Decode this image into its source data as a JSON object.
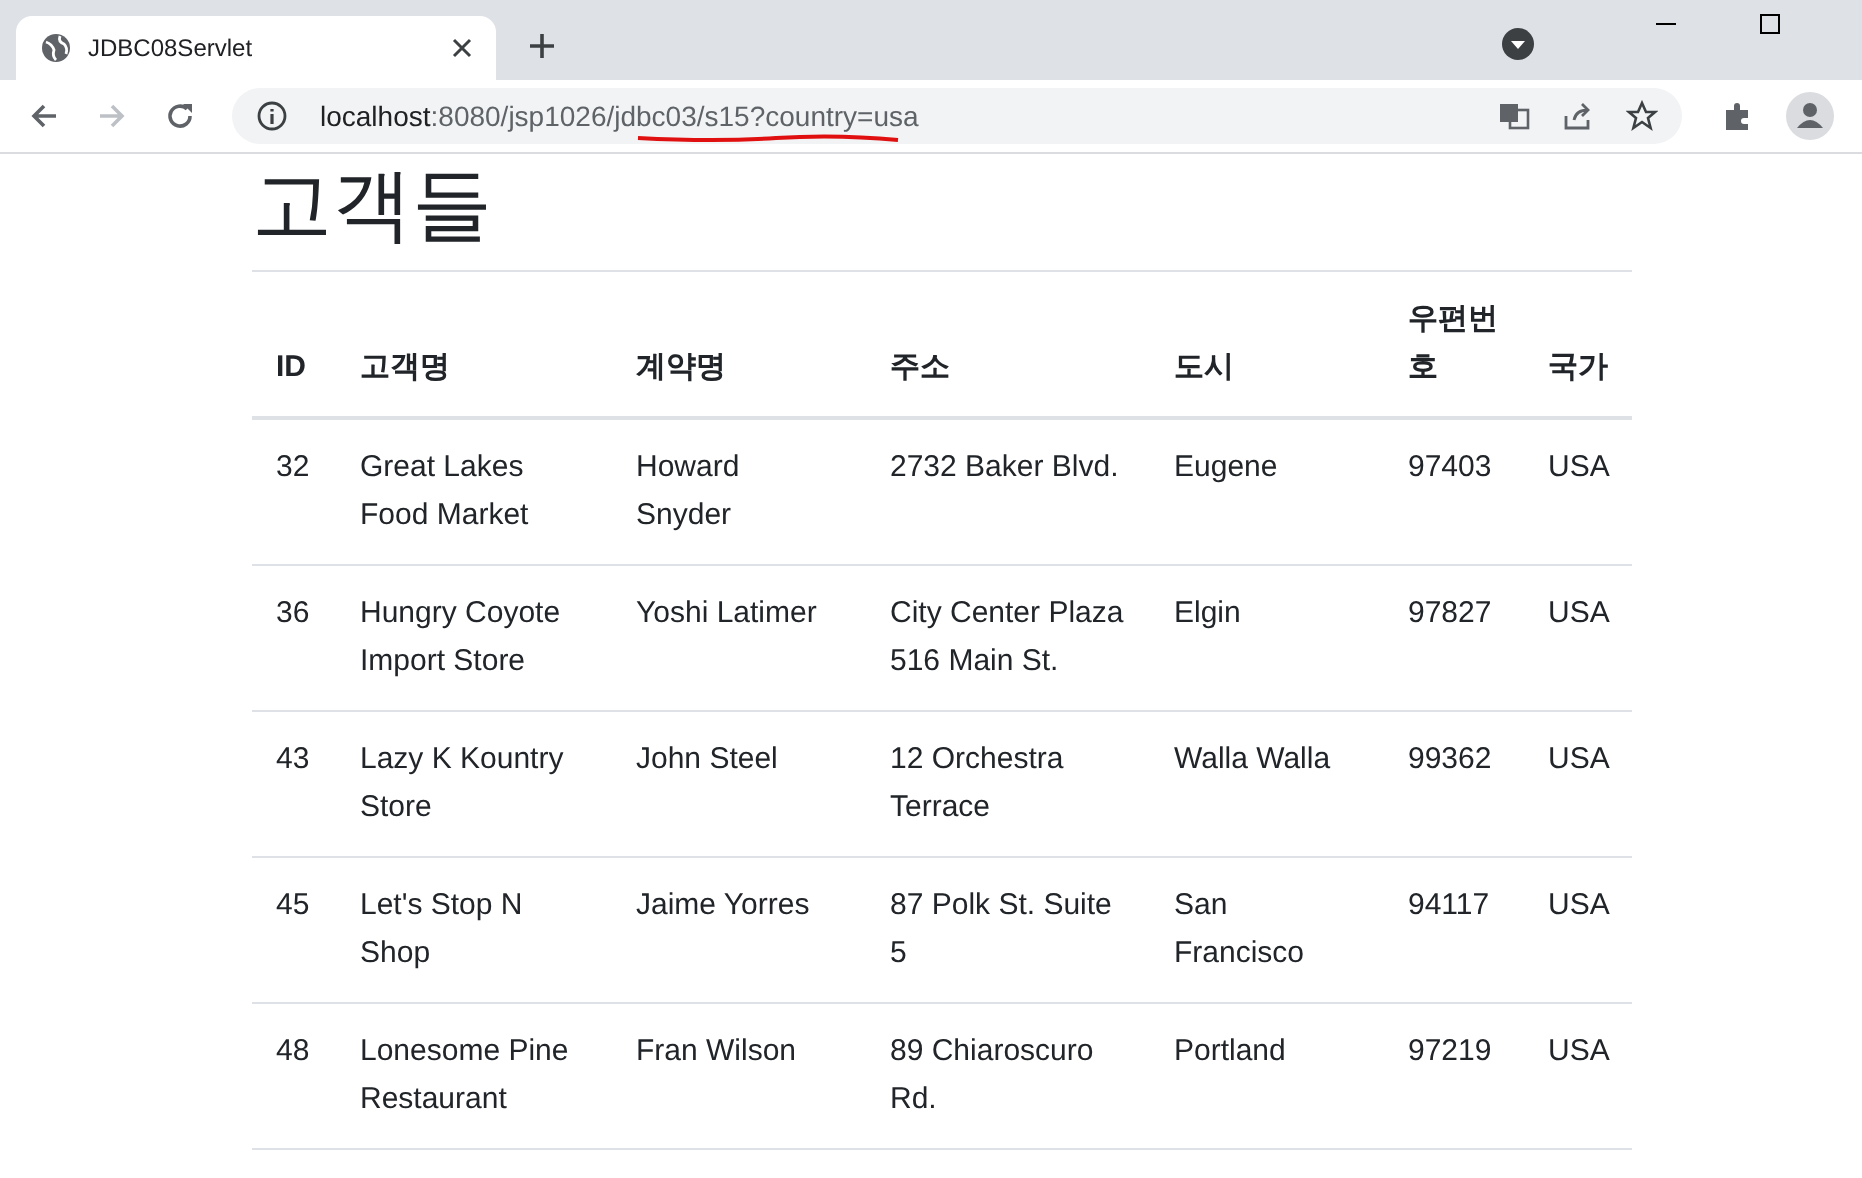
{
  "browser": {
    "tab": {
      "title": "JDBC08Servlet"
    },
    "address": {
      "host": "localhost",
      "rest": ":8080/jsp1026/jdbc03/s15?country=usa"
    }
  },
  "page": {
    "heading": "고객들",
    "table": {
      "columns": [
        "ID",
        "고객명",
        "계약명",
        "주소",
        "도시",
        "우편번호",
        "국가"
      ],
      "rows": [
        [
          "32",
          "Great Lakes Food Market",
          "Howard Snyder",
          "2732 Baker Blvd.",
          "Eugene",
          "97403",
          "USA"
        ],
        [
          "36",
          "Hungry Coyote Import Store",
          "Yoshi Latimer",
          "City Center Plaza 516 Main St.",
          "Elgin",
          "97827",
          "USA"
        ],
        [
          "43",
          "Lazy K Kountry Store",
          "John Steel",
          "12 Orchestra Terrace",
          "Walla Walla",
          "99362",
          "USA"
        ],
        [
          "45",
          "Let's Stop N Shop",
          "Jaime Yorres",
          "87 Polk St. Suite 5",
          "San Francisco",
          "94117",
          "USA"
        ],
        [
          "48",
          "Lonesome Pine Restaurant",
          "Fran Wilson",
          "89 Chiaroscuro Rd.",
          "Portland",
          "97219",
          "USA"
        ]
      ]
    }
  }
}
